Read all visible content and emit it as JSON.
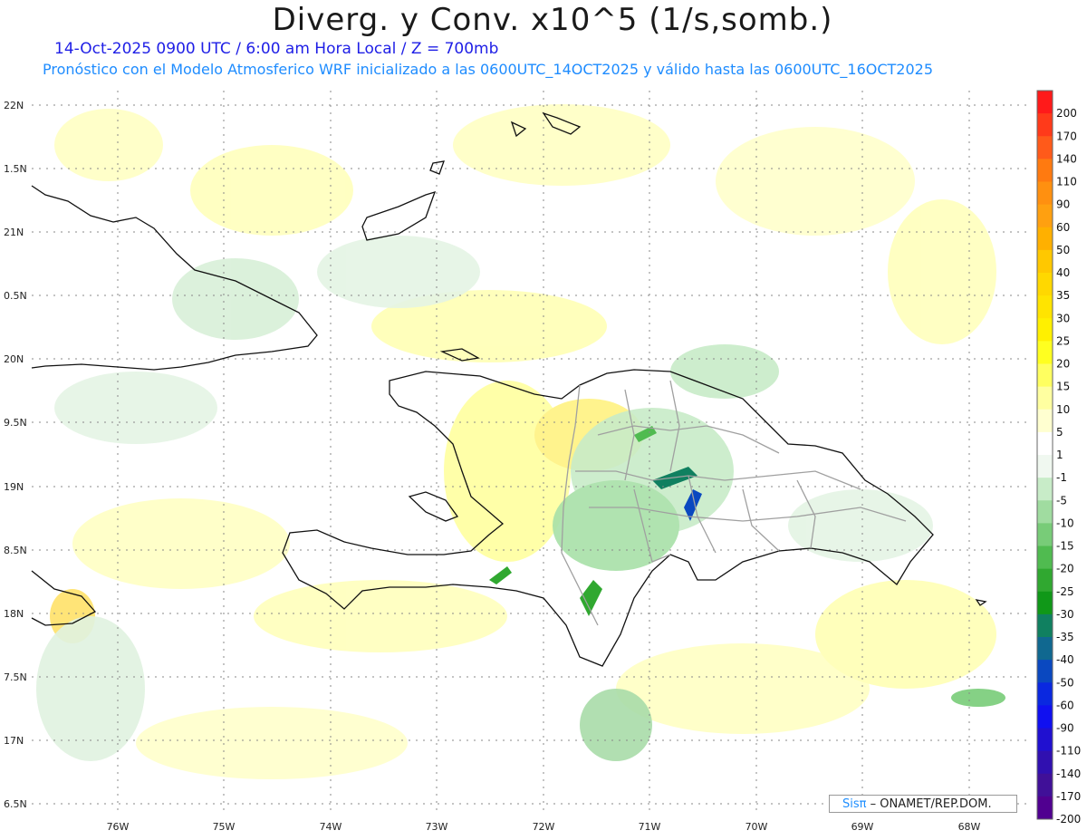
{
  "header": {
    "title": "Diverg. y Conv. x10^5 (1/s,somb.)",
    "subtitle_time": "14-Oct-2025  0900 UTC / 6:00 am Hora Local / Z = 700mb",
    "subtitle_model": "Pronóstico con el Modelo Atmosferico WRF inicializado a las 0600UTC_14OCT2025 y válido hasta las  0600UTC_16OCT2025"
  },
  "map": {
    "lat_labels": [
      "22N",
      "1.5N",
      "21N",
      "0.5N",
      "20N",
      "9.5N",
      "19N",
      "8.5N",
      "18N",
      "7.5N",
      "17N",
      "6.5N"
    ],
    "lon_labels": [
      "76W",
      "75W",
      "74W",
      "73W",
      "72W",
      "71W",
      "70W",
      "69W",
      "68W"
    ]
  },
  "colorbar": {
    "levels": [
      "200",
      "170",
      "140",
      "110",
      "90",
      "60",
      "50",
      "40",
      "35",
      "30",
      "25",
      "20",
      "15",
      "10",
      "5",
      "1",
      "-1",
      "-5",
      "-10",
      "-15",
      "-20",
      "-25",
      "-30",
      "-35",
      "-40",
      "-50",
      "-60",
      "-90",
      "-110",
      "-140",
      "-170",
      "-200"
    ],
    "colors": [
      "#ff1a1a",
      "#ff3a1a",
      "#ff5a1a",
      "#ff7a10",
      "#ff9010",
      "#ffa010",
      "#ffb000",
      "#ffc800",
      "#ffd800",
      "#ffe400",
      "#fff000",
      "#ffff20",
      "#ffff60",
      "#ffffa0",
      "#ffffd0",
      "#ffffff",
      "#f0f8f0",
      "#c8ecc8",
      "#a0dca0",
      "#78cc78",
      "#50bb50",
      "#30a830",
      "#109818",
      "#108060",
      "#106890",
      "#0a48c0",
      "#0a28e0",
      "#1010f0",
      "#2010d0",
      "#3010b0",
      "#401098",
      "#500090"
    ]
  },
  "credit": {
    "brand": "Sisπ",
    "text": " – ONAMET/REP.DOM."
  }
}
